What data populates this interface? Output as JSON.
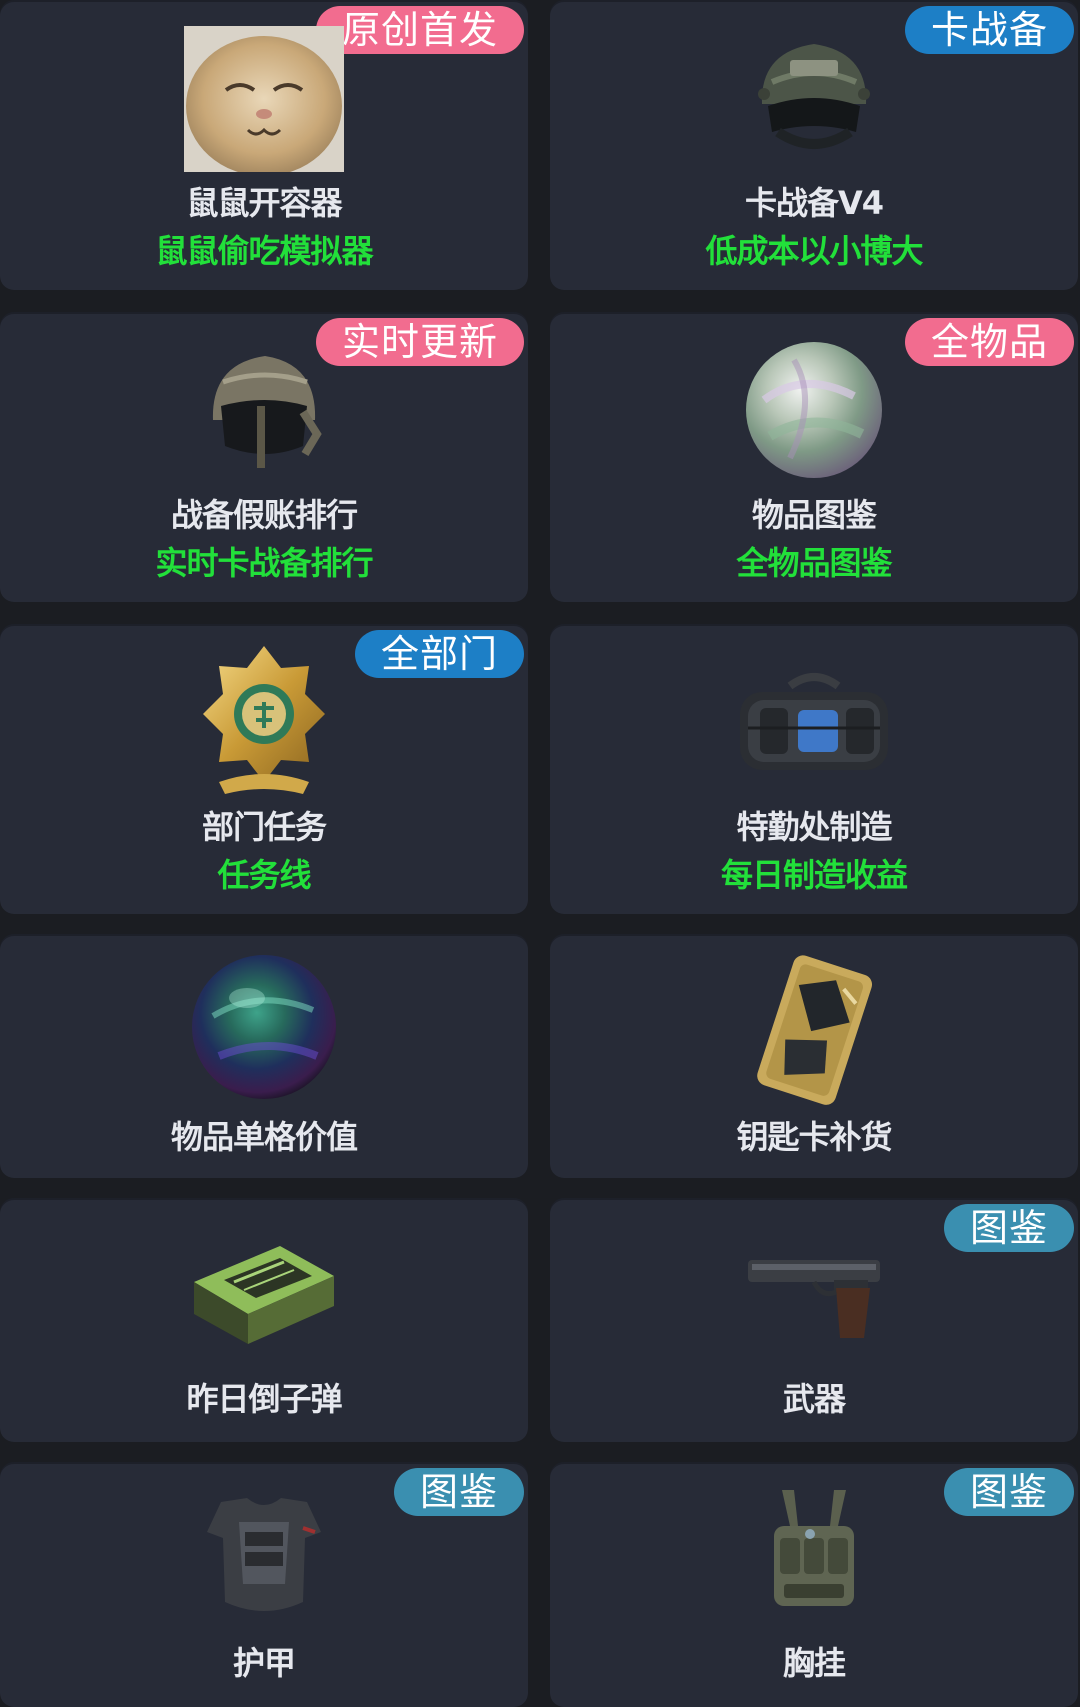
{
  "cards": [
    {
      "title": "鼠鼠开容器",
      "subtitle": "鼠鼠偷吃模拟器",
      "badge": "原创首发",
      "badge_color": "#f26c8f",
      "icon": "cat-face-icon"
    },
    {
      "title": "卡战备V4",
      "subtitle": "低成本以小博大",
      "badge": "卡战备",
      "badge_color": "#1d7fc6",
      "icon": "tactical-helmet-icon"
    },
    {
      "title": "战备假账排行",
      "subtitle": "实时卡战备排行",
      "badge": "实时更新",
      "badge_color": "#f26c8f",
      "icon": "armored-helmet-icon"
    },
    {
      "title": "物品图鉴",
      "subtitle": "全物品图鉴",
      "badge": "全物品",
      "badge_color": "#f26c8f",
      "icon": "pearl-orb-icon"
    },
    {
      "title": "部门任务",
      "subtitle": "任务线",
      "badge": "全部门",
      "badge_color": "#1d7fc6",
      "icon": "gold-badge-icon"
    },
    {
      "title": "特勤处制造",
      "subtitle": "每日制造收益",
      "badge": "",
      "badge_color": "",
      "icon": "duffel-bag-icon"
    },
    {
      "title": "物品单格价值",
      "subtitle": "",
      "badge": "",
      "badge_color": "",
      "icon": "iridescent-sphere-icon"
    },
    {
      "title": "钥匙卡补货",
      "subtitle": "",
      "badge": "",
      "badge_color": "",
      "icon": "keycard-icon"
    },
    {
      "title": "昨日倒子弹",
      "subtitle": "",
      "badge": "",
      "badge_color": "",
      "icon": "ammo-box-icon"
    },
    {
      "title": "武器",
      "subtitle": "",
      "badge": "图鉴",
      "badge_color": "#3a8fb0",
      "icon": "pistol-icon"
    },
    {
      "title": "护甲",
      "subtitle": "",
      "badge": "图鉴",
      "badge_color": "#3a8fb0",
      "icon": "body-armor-icon"
    },
    {
      "title": "胸挂",
      "subtitle": "",
      "badge": "图鉴",
      "badge_color": "#3a8fb0",
      "icon": "chest-rig-icon"
    }
  ]
}
